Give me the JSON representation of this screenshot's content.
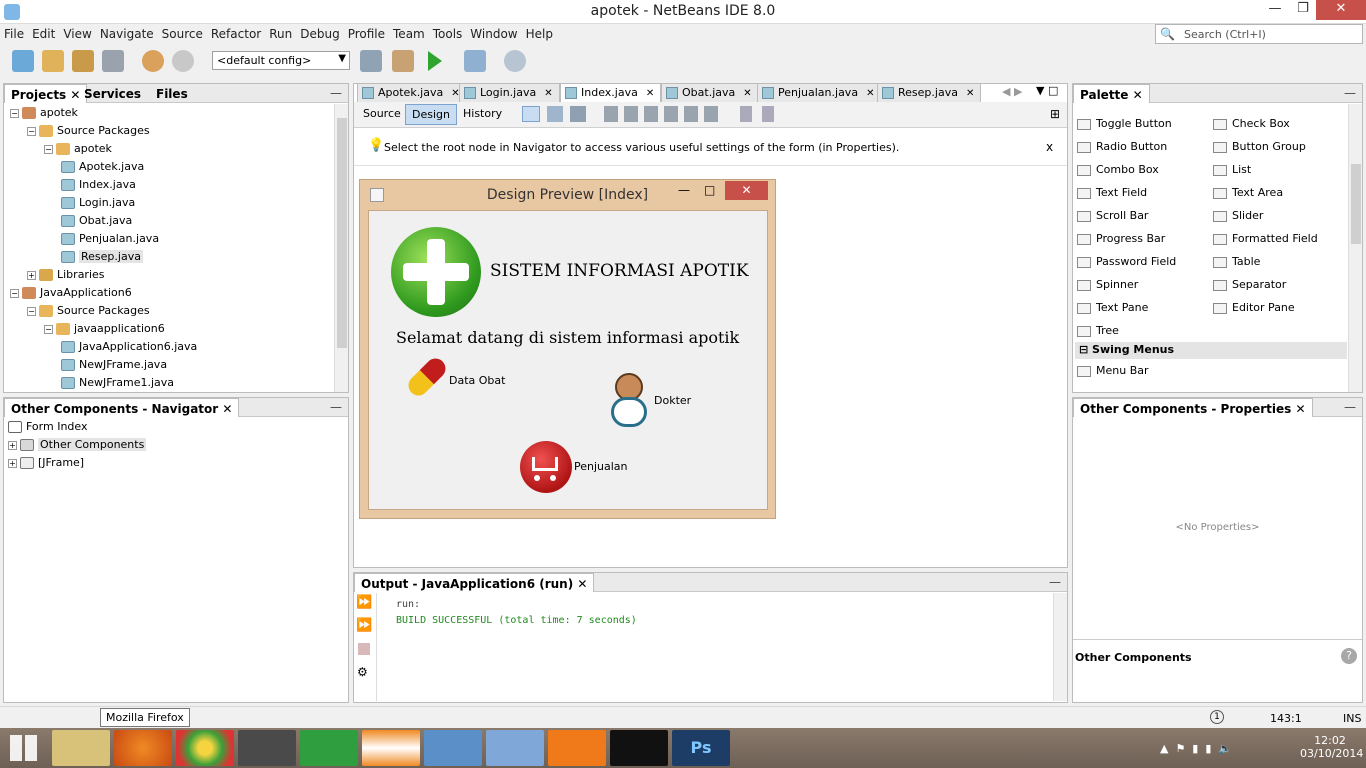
{
  "window": {
    "title": "apotek - NetBeans IDE 8.0"
  },
  "menu": [
    "File",
    "Edit",
    "View",
    "Navigate",
    "Source",
    "Refactor",
    "Run",
    "Debug",
    "Profile",
    "Team",
    "Tools",
    "Window",
    "Help"
  ],
  "search": {
    "placeholder": "Search (Ctrl+I)"
  },
  "toolbar": {
    "config": "<default config>"
  },
  "projects_panel": {
    "tabs": [
      "Projects",
      "Services",
      "Files"
    ],
    "tree": [
      {
        "label": "apotek",
        "type": "project",
        "level": 0
      },
      {
        "label": "Source Packages",
        "type": "package-root",
        "level": 1
      },
      {
        "label": "apotek",
        "type": "package",
        "level": 2
      },
      {
        "label": "Apotek.java",
        "type": "java",
        "level": 3
      },
      {
        "label": "Index.java",
        "type": "java",
        "level": 3
      },
      {
        "label": "Login.java",
        "type": "java",
        "level": 3
      },
      {
        "label": "Obat.java",
        "type": "java",
        "level": 3
      },
      {
        "label": "Penjualan.java",
        "type": "java",
        "level": 3
      },
      {
        "label": "Resep.java",
        "type": "java",
        "level": 3,
        "selected": true
      },
      {
        "label": "Libraries",
        "type": "library",
        "level": 1
      },
      {
        "label": "JavaApplication6",
        "type": "project",
        "level": 0
      },
      {
        "label": "Source Packages",
        "type": "package-root",
        "level": 1
      },
      {
        "label": "javaapplication6",
        "type": "package",
        "level": 2
      },
      {
        "label": "JavaApplication6.java",
        "type": "java",
        "level": 3
      },
      {
        "label": "NewJFrame.java",
        "type": "java",
        "level": 3
      },
      {
        "label": "NewJFrame1.java",
        "type": "java",
        "level": 3
      }
    ]
  },
  "navigator_panel": {
    "title": "Other Components - Navigator",
    "items": [
      "Form Index",
      "Other Components",
      "[JFrame]"
    ]
  },
  "editor": {
    "tabs": [
      "Apotek.java",
      "Login.java",
      "Index.java",
      "Obat.java",
      "Penjualan.java",
      "Resep.java"
    ],
    "subtabs": [
      "Source",
      "Design",
      "History"
    ],
    "hint": "Select the root node in Navigator to access various useful settings of the form (in Properties).",
    "hint_close": "x"
  },
  "preview": {
    "title": "Design Preview [Index]",
    "heading": "SISTEM INFORMASI APOTIK",
    "welcome": "Selamat datang di sistem informasi apotik",
    "buttons": {
      "obat": "Data Obat",
      "dokter": "Dokter",
      "penjualan": "Penjualan"
    }
  },
  "output_panel": {
    "title": "Output - JavaApplication6 (run)",
    "lines": [
      "run:",
      "BUILD SUCCESSFUL (total time: 7 seconds)"
    ]
  },
  "palette": {
    "title": "Palette",
    "left": [
      "Toggle Button",
      "Radio Button",
      "Combo Box",
      "Text Field",
      "Scroll Bar",
      "Progress Bar",
      "Password Field",
      "Spinner",
      "Text Pane",
      "Tree"
    ],
    "right": [
      "Check Box",
      "Button Group",
      "List",
      "Text Area",
      "Slider",
      "Formatted Field",
      "Table",
      "Separator",
      "Editor Pane"
    ],
    "section": "Swing Menus",
    "menu_item": "Menu Bar"
  },
  "properties_panel": {
    "title": "Other Components - Properties",
    "empty": "<No Properties>",
    "footer": "Other Components"
  },
  "status": {
    "position": "143:1",
    "mode": "INS"
  },
  "tooltip": "Mozilla Firefox",
  "clock": {
    "time": "12:02",
    "date": "03/10/2014"
  },
  "colors": {
    "accent": "#c9ddf2",
    "close_red": "#c7504b",
    "build_green": "#1f8a1f",
    "preview_frame": "#e8c7a3"
  }
}
